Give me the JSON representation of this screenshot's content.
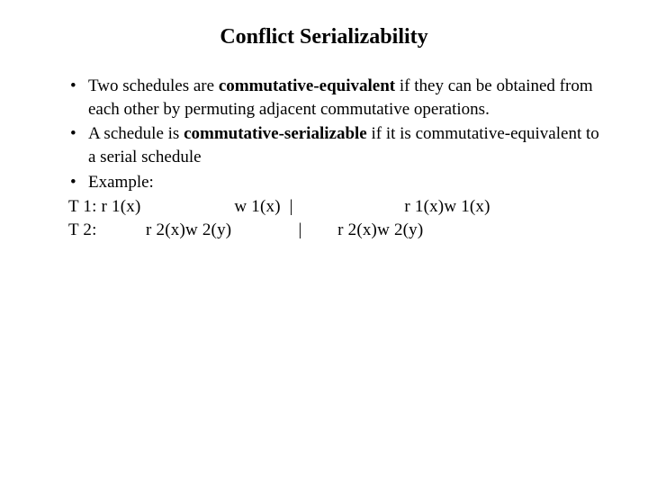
{
  "title": "Conflict Serializability",
  "bullets": {
    "b1_pre": "Two schedules are ",
    "b1_bold": "commutative-equivalent",
    "b1_post": " if they can be obtained from each other by permuting adjacent commutative operations.",
    "b2_pre": "A schedule is ",
    "b2_bold": "commutative-serializable",
    "b2_post": " if it is commutative-equivalent to a serial schedule",
    "b3": "Example:"
  },
  "example": {
    "line1": "T 1: r 1(x)                     w 1(x)  |                         r 1(x)w 1(x)",
    "line2": "T 2:           r 2(x)w 2(y)               |        r 2(x)w 2(y)"
  }
}
